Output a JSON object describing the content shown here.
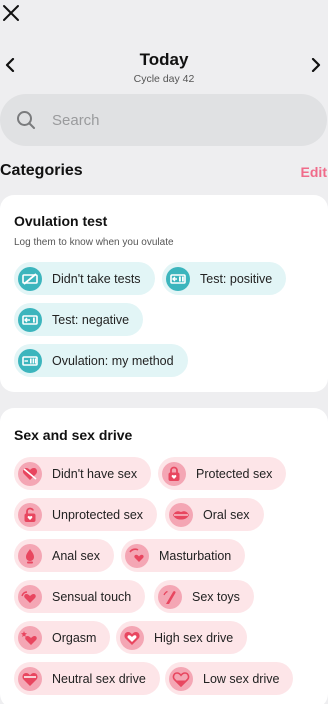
{
  "header": {
    "title": "Today",
    "subtitle": "Cycle day 42"
  },
  "search": {
    "placeholder": "Search"
  },
  "categories": {
    "label": "Categories",
    "edit_label": "Edit"
  },
  "ovulation": {
    "title": "Ovulation test",
    "subtitle": "Log them to know when you ovulate",
    "chips": [
      {
        "label": "Didn't take tests",
        "icon": "test-none-icon"
      },
      {
        "label": "Test: positive",
        "icon": "test-positive-icon"
      },
      {
        "label": "Test: negative",
        "icon": "test-negative-icon"
      },
      {
        "label": "Ovulation: my method",
        "icon": "ovulation-method-icon"
      }
    ]
  },
  "sex": {
    "title": "Sex and sex drive",
    "chips": [
      {
        "label": "Didn't have sex",
        "icon": "no-sex-heart-icon"
      },
      {
        "label": "Protected sex",
        "icon": "lock-heart-icon"
      },
      {
        "label": "Unprotected sex",
        "icon": "unlock-heart-icon"
      },
      {
        "label": "Oral sex",
        "icon": "lips-icon"
      },
      {
        "label": "Anal sex",
        "icon": "anal-icon"
      },
      {
        "label": "Masturbation",
        "icon": "masturbation-icon"
      },
      {
        "label": "Sensual touch",
        "icon": "touch-icon"
      },
      {
        "label": "Sex toys",
        "icon": "sex-toy-icon"
      },
      {
        "label": "Orgasm",
        "icon": "orgasm-icon"
      },
      {
        "label": "High sex drive",
        "icon": "high-drive-icon"
      },
      {
        "label": "Neutral sex drive",
        "icon": "neutral-drive-icon"
      },
      {
        "label": "Low sex drive",
        "icon": "low-drive-icon"
      }
    ]
  },
  "colors": {
    "accent": "#f06b8a",
    "teal": "#3cb5bd",
    "teal_chip": "#e2f5f6",
    "pink_chip": "#fde5e8",
    "pink_icon": "#f4a6b4"
  }
}
